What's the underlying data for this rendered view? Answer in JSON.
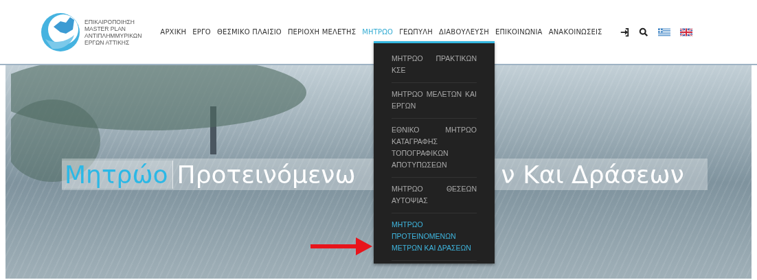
{
  "logo": {
    "lines": [
      "ΕΠΙΚΑΙΡΟΠΟΙΗΣΗ",
      "MASTER PLAN",
      "ΑΝΤΙΠΛΗΜΜΥΡΙΚΩΝ",
      "ΕΡΓΩΝ ΑΤΤΙΚΗΣ"
    ]
  },
  "nav": [
    {
      "label": "ΑΡΧΙΚΗ",
      "selected": false
    },
    {
      "label": "ΕΡΓΟ",
      "selected": false
    },
    {
      "label": "ΘΕΣΜΙΚΟ ΠΛΑΙΣΙΟ",
      "selected": false
    },
    {
      "label": "ΠΕΡΙΟΧΗ ΜΕΛΕΤΗΣ",
      "selected": false
    },
    {
      "label": "ΜΗΤΡΩΟ",
      "selected": true
    },
    {
      "label": "ΓΕΩΠΥΛΗ",
      "selected": false
    },
    {
      "label": "ΔΙΑΒΟΥΛΕΥΣΗ",
      "selected": false
    },
    {
      "label": "ΕΠΙΚΟΙΝΩΝΙΑ",
      "selected": false
    },
    {
      "label": "ΑΝΑΚΟΙΝΩΣΕΙΣ",
      "selected": false
    }
  ],
  "tools": [
    {
      "kind": "login"
    },
    {
      "kind": "search"
    },
    {
      "kind": "flag-gr"
    },
    {
      "kind": "flag-uk"
    }
  ],
  "dropdown": [
    {
      "label": "ΜΗΤΡΩΟ ΠΡΑΚΤΙΚΩΝ ΚΣΕ",
      "selected": false
    },
    {
      "label": "ΜΗΤΡΩΟ ΜΕΛΕΤΩΝ ΚΑΙ ΕΡΓΩΝ",
      "selected": false
    },
    {
      "label": "ΕΘΝΙΚΟ ΜΗΤΡΩΟ ΚΑΤΑΓΡΑΦΗΣ ΤΟΠΟΓΡΑΦΙΚΩΝ ΑΠΟΤΥΠΩΣΕΩΝ",
      "selected": false
    },
    {
      "label": "ΜΗΤΡΩΟ ΘΕΣΕΩΝ ΑΥΤΟΨΙΑΣ",
      "selected": false
    },
    {
      "label": "ΜΗΤΡΩΟ ΠΡΟΤΕΙΝΟΜΕΝΩΝ ΜΕΤΡΩΝ ΚΑΙ ΔΡΑΣΕΩΝ",
      "selected": true
    }
  ],
  "hero": {
    "highlight": "Μητρώο",
    "title_parts": [
      "Προτεινόμενω",
      "ν Και Δράσεων"
    ]
  }
}
